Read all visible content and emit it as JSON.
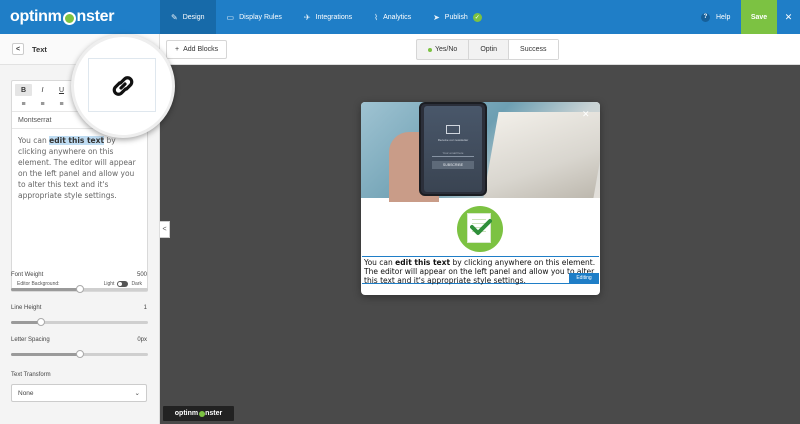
{
  "brand": {
    "logo_pre": "optinm",
    "logo_post": "nster",
    "accent": "#1f7ec7",
    "green": "#7cc242"
  },
  "topnav": {
    "items": [
      {
        "label": "Design",
        "icon": "brush-icon",
        "active": true
      },
      {
        "label": "Display Rules",
        "icon": "monitor-icon"
      },
      {
        "label": "Integrations",
        "icon": "plane-icon"
      },
      {
        "label": "Analytics",
        "icon": "chart-icon"
      },
      {
        "label": "Publish",
        "icon": "send-icon"
      }
    ],
    "help_label": "Help",
    "help_glyph": "?",
    "save_label": "Save",
    "close_glyph": "✕"
  },
  "toolbar": {
    "add_blocks_label": "Add Blocks",
    "add_blocks_glyph": "+",
    "views": [
      {
        "label": "Yes/No",
        "active": false
      },
      {
        "label": "Optin",
        "active": false
      },
      {
        "label": "Success",
        "active": true
      }
    ]
  },
  "panel": {
    "back_glyph": "<",
    "title": "Text",
    "format_buttons": [
      "B",
      "I",
      "U",
      "S"
    ],
    "font_name": "Montserrat",
    "editor_text_pre": "You can ",
    "editor_text_highlight": "edit this text",
    "editor_text_post": " by clicking anywhere on this element. The editor will appear on the left panel and allow you to alter this text and it's appropriate style settings.",
    "editor_background_label": "Editor Background:",
    "light_label": "Light",
    "dark_label": "Dark",
    "font_weight": {
      "label": "Font Weight",
      "value": "500",
      "fraction": 0.5
    },
    "line_height": {
      "label": "Line Height",
      "value": "1",
      "fraction": 0.22
    },
    "letter_spacing": {
      "label": "Letter Spacing",
      "value": "0px",
      "fraction": 0.5
    },
    "text_transform": {
      "label": "Text Transform",
      "value": "None",
      "chevron": "⌄"
    }
  },
  "magnifier": {
    "icon": "link-icon"
  },
  "collapse_glyph": "<",
  "popup": {
    "close_glyph": "✕",
    "phone_line1": "Receive our newsletter",
    "phone_field": "Your email here",
    "phone_button": "SUBSCRIBE",
    "text_pre": "You can ",
    "text_bold": "edit this text",
    "text_post": " by clicking anywhere on this element. The editor will appear on the left panel and allow you to alter this text and it's appropriate style settings.",
    "editing_label": "Editing"
  },
  "footer_logo": {
    "pre": "optinm",
    "post": "nster"
  }
}
